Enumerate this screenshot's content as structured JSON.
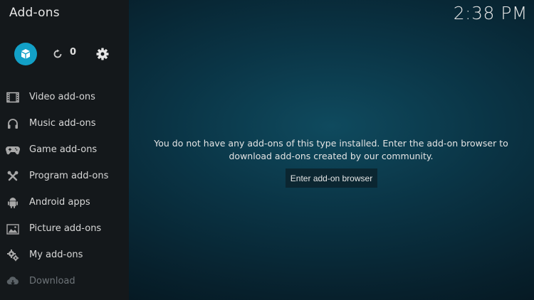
{
  "header": {
    "title": "Add-ons",
    "clock": "2:38 PM"
  },
  "toolbar": {
    "update_count": "0"
  },
  "menu": {
    "items": [
      {
        "label": "Video add-ons",
        "icon": "film-icon"
      },
      {
        "label": "Music add-ons",
        "icon": "headphones-icon"
      },
      {
        "label": "Game add-ons",
        "icon": "gamepad-icon"
      },
      {
        "label": "Program add-ons",
        "icon": "tools-icon"
      },
      {
        "label": "Android apps",
        "icon": "android-icon"
      },
      {
        "label": "Picture add-ons",
        "icon": "picture-icon"
      },
      {
        "label": "My add-ons",
        "icon": "gears-icon"
      },
      {
        "label": "Download",
        "icon": "download-icon"
      }
    ]
  },
  "main": {
    "message": "You do not have any add-ons of this type installed. Enter the add-on browser to download add-ons created by our community.",
    "browser_button_label": "Enter add-on browser"
  },
  "colors": {
    "accent": "#12a0c7",
    "sidebar_bg": "#14181b",
    "button_bg": "#0b2631"
  }
}
